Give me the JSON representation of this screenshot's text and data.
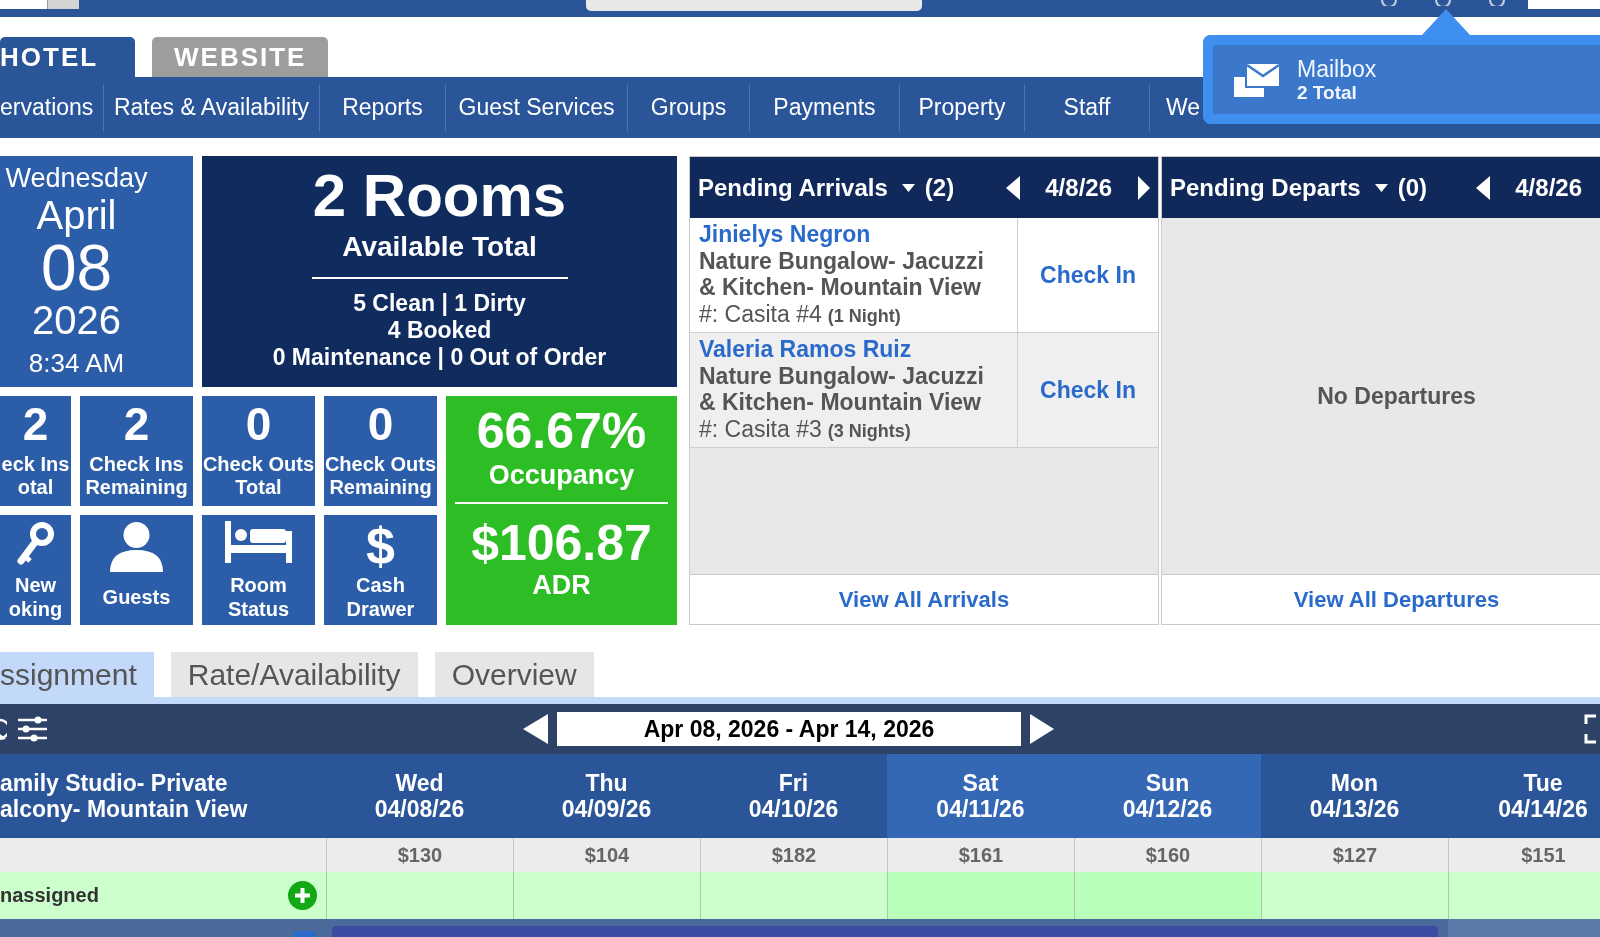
{
  "product_tabs": [
    {
      "label": "HOTEL",
      "selected": true
    },
    {
      "label": "WEBSITE",
      "selected": false
    }
  ],
  "nav_menu": [
    "ervations",
    "Rates & Availability",
    "Reports",
    "Guest Services",
    "Groups",
    "Payments",
    "Property",
    "Staff",
    "We"
  ],
  "mailbox_popup": {
    "title": "Mailbox",
    "count": "2 Total"
  },
  "date_tile": {
    "weekday": "Wednesday",
    "month": "April",
    "day": "08",
    "year": "2026",
    "time": "8:34 AM"
  },
  "rooms_tile": {
    "headline": "2 Rooms",
    "subtitle": "Available Total",
    "lines": [
      "5 Clean | 1 Dirty",
      "4 Booked",
      "0 Maintenance | 0 Out of Order"
    ]
  },
  "stat_tiles": [
    {
      "value": "2",
      "label": "eck Ins otal"
    },
    {
      "value": "2",
      "label": "Check Ins Remaining"
    },
    {
      "value": "0",
      "label": "Check Outs Total"
    },
    {
      "value": "0",
      "label": "Check Outs Remaining"
    }
  ],
  "action_tiles": [
    {
      "label": "New oking"
    },
    {
      "label": "Guests"
    },
    {
      "label": "Room Status"
    },
    {
      "symbol": "$",
      "label": "Cash Drawer"
    }
  ],
  "occupancy_tile": {
    "occupancy": "66.67%",
    "occupancy_label": "Occupancy",
    "adr": "$106.87",
    "adr_label": "ADR"
  },
  "arrivals": {
    "title": "Pending Arrivals",
    "count": "(2)",
    "date": "4/8/26",
    "has_next": true,
    "rows": [
      {
        "guest": "Jinielys Negron",
        "room_type": "Nature Bungalow- Jacuzzi & Kitchen- Mountain View",
        "unit": "#: Casita #4",
        "nights": "(1 Night)",
        "action": "Check In"
      },
      {
        "guest": "Valeria Ramos Ruiz",
        "room_type": "Nature Bungalow- Jacuzzi & Kitchen- Mountain View",
        "unit": "#: Casita #3",
        "nights": "(3 Nights)",
        "action": "Check In"
      }
    ],
    "footer_link": "View All Arrivals"
  },
  "departures": {
    "title": "Pending Departs",
    "count": "(0)",
    "date": "4/8/26",
    "has_next": false,
    "empty_message": "No Departures",
    "footer_link": "View All Departures"
  },
  "view_tabs": [
    {
      "label": "ssignment",
      "selected": true
    },
    {
      "label": "Rate/Availability",
      "selected": false
    },
    {
      "label": "Overview",
      "selected": false
    }
  ],
  "date_range": "Apr 08, 2026 - Apr 14, 2026",
  "calendar": {
    "room_type": "amily Studio- Private alcony- Mountain View",
    "days": [
      {
        "weekday": "Wed",
        "date": "04/08/26",
        "price": "$130",
        "weekend": false
      },
      {
        "weekday": "Thu",
        "date": "04/09/26",
        "price": "$104",
        "weekend": false
      },
      {
        "weekday": "Fri",
        "date": "04/10/26",
        "price": "$182",
        "weekend": false
      },
      {
        "weekday": "Sat",
        "date": "04/11/26",
        "price": "$161",
        "weekend": true
      },
      {
        "weekday": "Sun",
        "date": "04/12/26",
        "price": "$160",
        "weekend": true
      },
      {
        "weekday": "Mon",
        "date": "04/13/26",
        "price": "$127",
        "weekend": false
      },
      {
        "weekday": "Tue",
        "date": "04/14/26",
        "price": "$151",
        "weekend": false
      }
    ],
    "unassigned_label": "nassigned"
  }
}
